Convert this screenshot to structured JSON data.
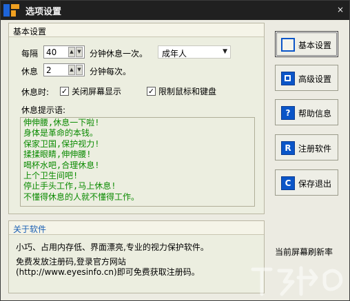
{
  "window": {
    "title": "选项设置",
    "close_glyph": "×"
  },
  "basic": {
    "header": "基本设置",
    "every_label": "每隔",
    "interval_value": "40",
    "interval_unit": "分钟休息一次。",
    "profile_selected": "成年人",
    "rest_label": "休息",
    "rest_value": "2",
    "rest_unit": "分钟每次。",
    "during_rest_label": "休息时:",
    "close_screen_label": "关闭屏幕显示",
    "close_screen_checked": true,
    "lock_input_label": "限制鼠标和键盘",
    "lock_input_checked": true,
    "tips_label": "休息提示语:",
    "tips": [
      "伸伸腰,休息一下啦!",
      "身体是革命的本钱。",
      "保家卫国,保护视力!",
      "揉揉眼睛,伸伸腰!",
      "喝杯水吧,合理休息!",
      "上个卫生间吧!",
      "停止手头工作,马上休息!",
      "不懂得休息的人就不懂得工作。"
    ]
  },
  "about": {
    "header": "关于软件",
    "line1": "小巧、占用内存低、界面漂亮,专业的视力保护软件。",
    "line2": "免费发放注册码,登录官方网站",
    "line3": "(http://www.eyesinfo.cn)即可免费获取注册码。"
  },
  "sidebar": {
    "buttons": [
      {
        "label": "基本设置",
        "icon_char": ""
      },
      {
        "label": "高级设置",
        "icon_char": ""
      },
      {
        "label": "帮助信息",
        "icon_char": "?"
      },
      {
        "label": "注册软件",
        "icon_char": "R"
      },
      {
        "label": "保存退出",
        "icon_char": "C"
      }
    ],
    "status": "当前屏幕刷新率"
  },
  "colors": {
    "titlebar": "#202020",
    "tips_text": "#0a8a00",
    "about_header": "#1a5fb4",
    "icon_blue": "#0a55c8"
  }
}
